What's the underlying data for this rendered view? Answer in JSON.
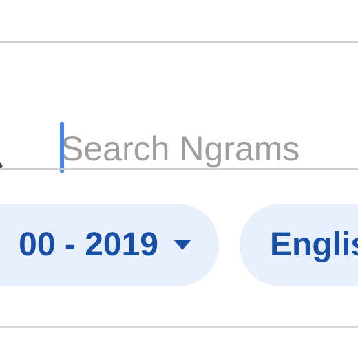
{
  "search": {
    "placeholder": "Search Ngrams",
    "value": "",
    "icon": "search-icon"
  },
  "filters": {
    "date_range": {
      "label": "00 - 2019",
      "icon": "chevron-down-icon"
    },
    "language": {
      "label": "Englis"
    }
  },
  "colors": {
    "chip_background": "#e8f0fe",
    "chip_text": "#174ea6",
    "caret": "#4285f4",
    "placeholder": "#9e9e9e",
    "divider": "#cfcfcf"
  }
}
